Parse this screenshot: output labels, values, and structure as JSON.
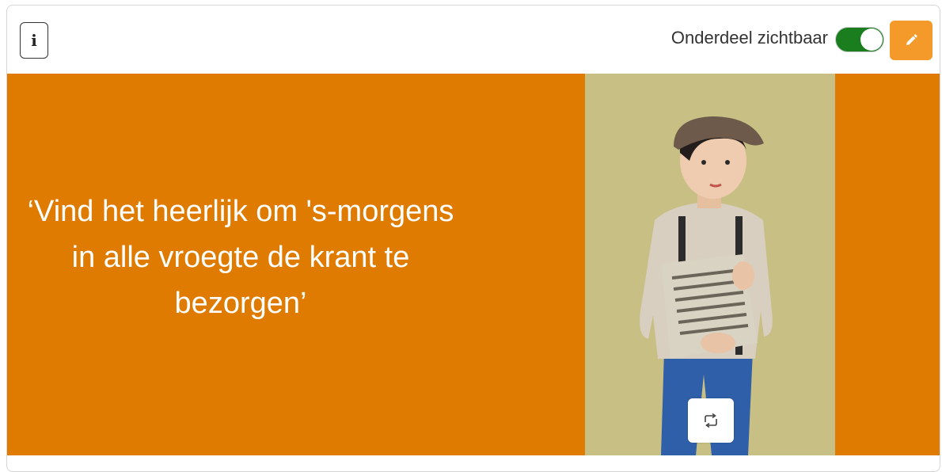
{
  "toolbar": {
    "info_icon_glyph": "i",
    "visibility_label": "Onderdeel zichtbaar",
    "visibility_on": true,
    "edit_icon": "pencil-icon"
  },
  "banner": {
    "quote": "‘Vind het heerlijk om 's-morgens in alle vroegte de krant te bezorgen’",
    "background_color": "#de7b00",
    "image_background_color": "#c8bf84",
    "swap_icon": "swap-arrows-icon"
  },
  "colors": {
    "accent": "#f39a2b",
    "toggle_on": "#1a7e1f"
  }
}
